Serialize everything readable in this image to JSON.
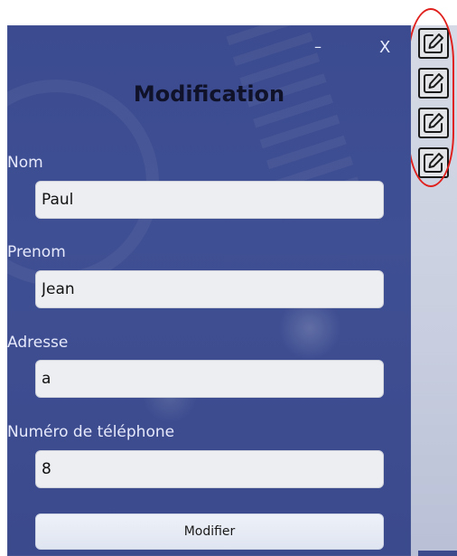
{
  "window": {
    "minimize_label": "–",
    "close_label": "X"
  },
  "dialog": {
    "title": "Modification",
    "fields": [
      {
        "label": "Nom",
        "value": "Paul"
      },
      {
        "label": "Prenom",
        "value": "Jean"
      },
      {
        "label": "Adresse",
        "value": "a"
      },
      {
        "label": "Numéro de téléphone",
        "value": "8"
      }
    ],
    "submit_label": "Modifier"
  },
  "side_list": {
    "edit_buttons": [
      {
        "icon": "edit-icon"
      },
      {
        "icon": "edit-icon"
      },
      {
        "icon": "edit-icon"
      },
      {
        "icon": "edit-icon"
      }
    ]
  },
  "annotation": {
    "highlight_color": "#e0201c"
  },
  "colors": {
    "dialog_background": "#3c4b8f",
    "title_text": "#10122a",
    "input_background": "#eceef2",
    "right_panel": "#cfd4e3"
  }
}
